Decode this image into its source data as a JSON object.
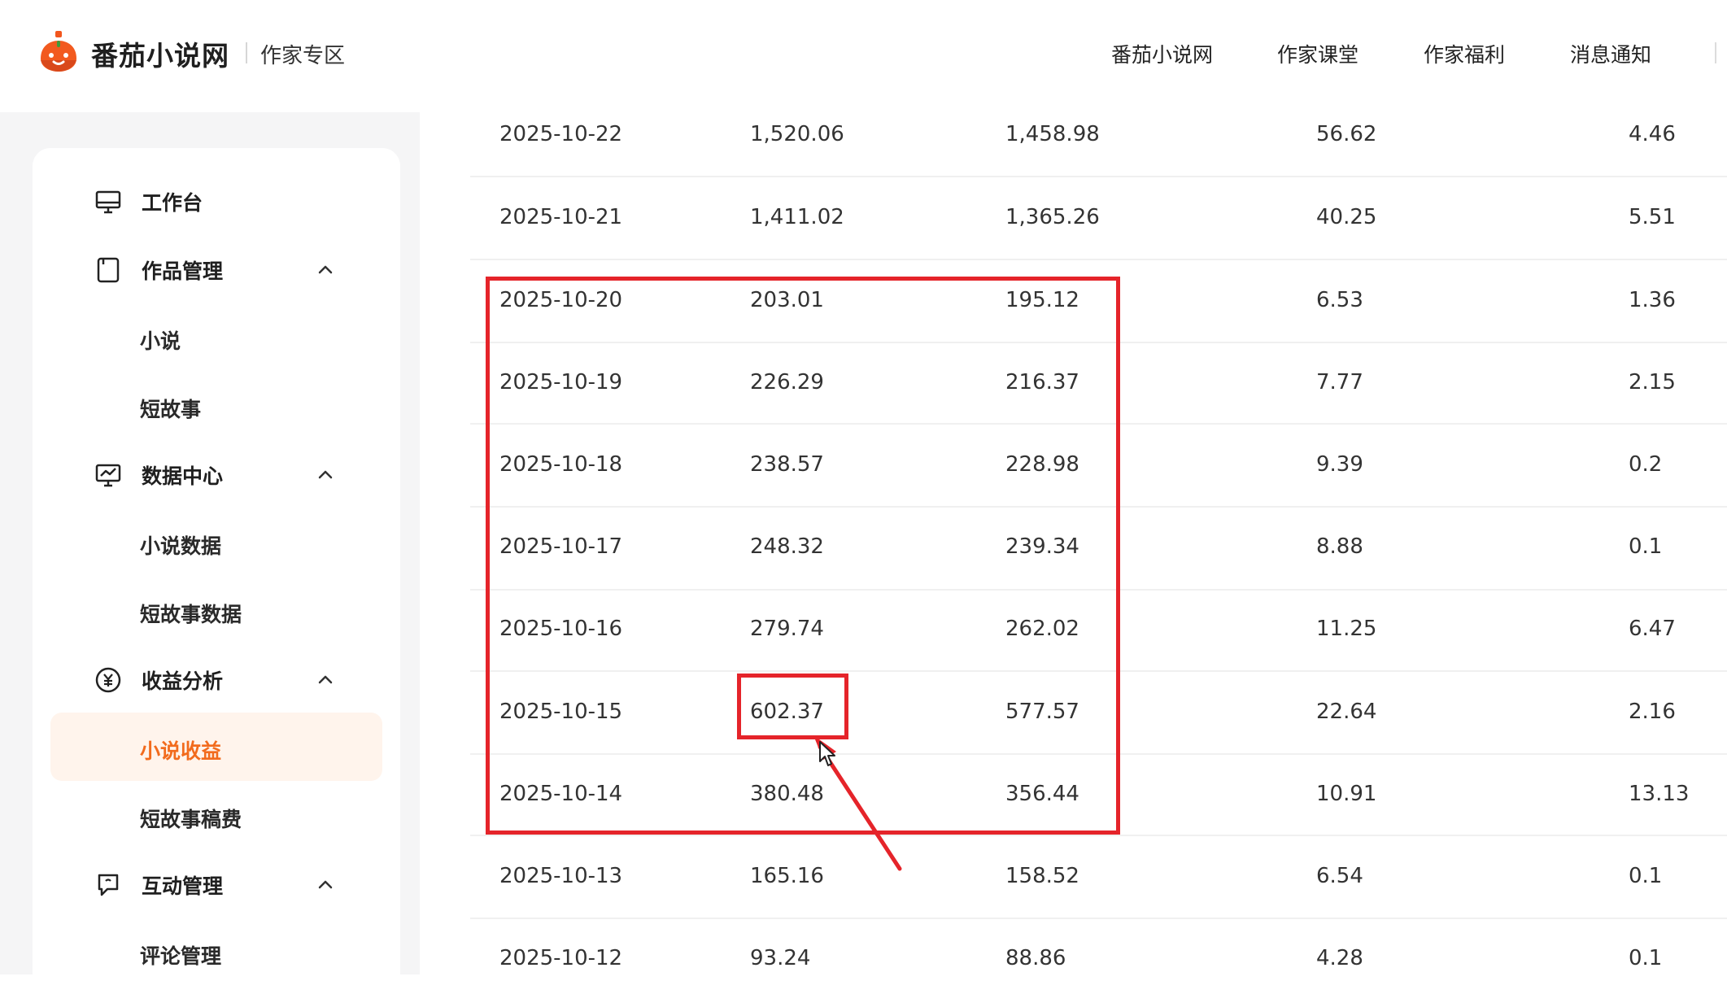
{
  "header": {
    "brand": "番茄小说网",
    "brand_sub": "作家专区",
    "nav": [
      "番茄小说网",
      "作家课堂",
      "作家福利",
      "消息通知"
    ]
  },
  "colors": {
    "accent": "#f26b1d",
    "annotation": "#e5242a",
    "sidebar_bg": "#f5f5f6",
    "active_bg": "#fff4ec"
  },
  "sidebar": {
    "groups": [
      {
        "label": "工作台",
        "icon": "monitor-icon",
        "expandable": false
      },
      {
        "label": "作品管理",
        "icon": "document-icon",
        "expandable": true,
        "items": [
          "小说",
          "短故事"
        ]
      },
      {
        "label": "数据中心",
        "icon": "chart-monitor-icon",
        "expandable": true,
        "items": [
          "小说数据",
          "短故事数据"
        ]
      },
      {
        "label": "收益分析",
        "icon": "yuan-circle-icon",
        "expandable": true,
        "items": [
          "小说收益",
          "短故事稿费"
        ]
      },
      {
        "label": "互动管理",
        "icon": "chat-icon",
        "expandable": true,
        "items": [
          "评论管理"
        ]
      }
    ],
    "active_item": "小说收益"
  },
  "table": {
    "rows": [
      [
        "2025-10-22",
        "1,520.06",
        "1,458.98",
        "56.62",
        "4.46"
      ],
      [
        "2025-10-21",
        "1,411.02",
        "1,365.26",
        "40.25",
        "5.51"
      ],
      [
        "2025-10-20",
        "203.01",
        "195.12",
        "6.53",
        "1.36"
      ],
      [
        "2025-10-19",
        "226.29",
        "216.37",
        "7.77",
        "2.15"
      ],
      [
        "2025-10-18",
        "238.57",
        "228.98",
        "9.39",
        "0.2"
      ],
      [
        "2025-10-17",
        "248.32",
        "239.34",
        "8.88",
        "0.1"
      ],
      [
        "2025-10-16",
        "279.74",
        "262.02",
        "11.25",
        "6.47"
      ],
      [
        "2025-10-15",
        "602.37",
        "577.57",
        "22.64",
        "2.16"
      ],
      [
        "2025-10-14",
        "380.48",
        "356.44",
        "10.91",
        "13.13"
      ],
      [
        "2025-10-13",
        "165.16",
        "158.52",
        "6.54",
        "0.1"
      ],
      [
        "2025-10-12",
        "93.24",
        "88.86",
        "4.28",
        "0.1"
      ]
    ]
  }
}
